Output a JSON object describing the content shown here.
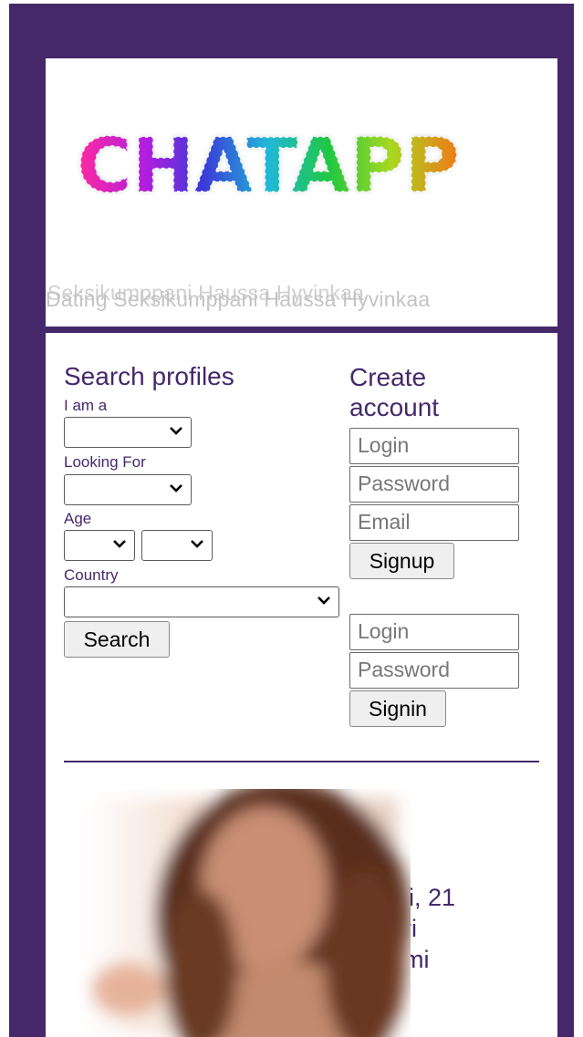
{
  "header": {
    "logo_text": "CHATAPP",
    "tagline_back": "Seksikumppani Haussa Hyvinkaa",
    "tagline_front": "Dating Seksikumppani Haussa Hyvinkaa"
  },
  "search": {
    "title": "Search profiles",
    "i_am_label": "I am a",
    "i_am_value": "",
    "looking_for_label": "Looking For",
    "looking_for_value": "",
    "age_label": "Age",
    "age_from_value": "",
    "age_to_value": "",
    "country_label": "Country",
    "country_value": "",
    "search_button": "Search"
  },
  "signup": {
    "title": "Create account",
    "login_placeholder": "Login",
    "password_placeholder": "Password",
    "email_placeholder": "Email",
    "signup_button": "Signup"
  },
  "signin": {
    "login_placeholder": "Login",
    "password_placeholder": "Password",
    "signin_button": "Signin"
  },
  "profile": {
    "line1": "li, 21",
    "line2": "ri",
    "line3": "mi"
  },
  "colors": {
    "brand": "#45286a",
    "button_bg": "#efefef"
  }
}
